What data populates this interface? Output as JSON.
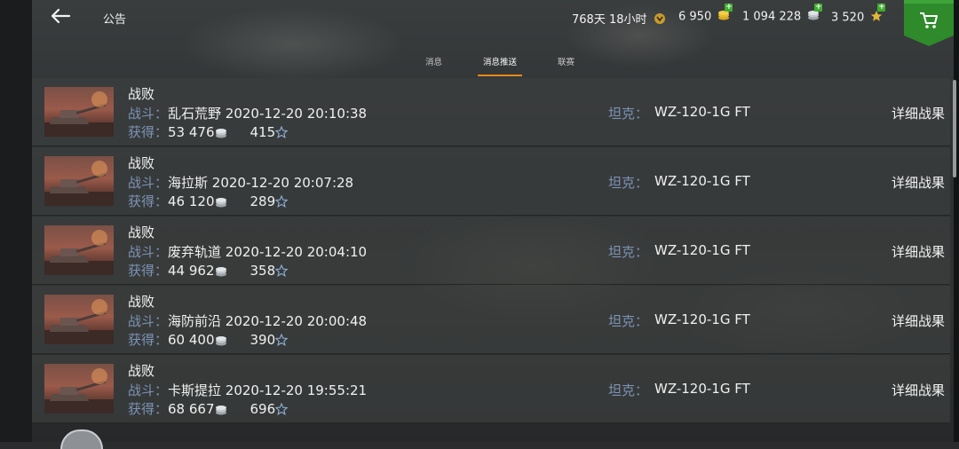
{
  "header": {
    "title": "公告",
    "premium_time": "768天 18小时",
    "gold": "6 950",
    "silver": "1 094 228",
    "free_xp": "3 520"
  },
  "tabs": [
    {
      "label": "消息",
      "active": false
    },
    {
      "label": "消息推送",
      "active": true
    },
    {
      "label": "联赛",
      "active": false
    }
  ],
  "colors": {
    "accent": "#e8881a",
    "label": "#7d93b6",
    "shop": "#2e8a2a"
  },
  "rows": [
    {
      "result": "战败",
      "battle_label": "战斗：",
      "map_time": "乱石荒野 2020-12-20 20:10:38",
      "earn_label": "获得：",
      "credits": "53 476",
      "xp": "415",
      "tank_label": "坦克：",
      "tank": "WZ-120-1G FT",
      "details": "详细战果"
    },
    {
      "result": "战败",
      "battle_label": "战斗：",
      "map_time": "海拉斯 2020-12-20 20:07:28",
      "earn_label": "获得：",
      "credits": "46 120",
      "xp": "289",
      "tank_label": "坦克：",
      "tank": "WZ-120-1G FT",
      "details": "详细战果"
    },
    {
      "result": "战败",
      "battle_label": "战斗：",
      "map_time": "废弃轨道 2020-12-20 20:04:10",
      "earn_label": "获得：",
      "credits": "44 962",
      "xp": "358",
      "tank_label": "坦克：",
      "tank": "WZ-120-1G FT",
      "details": "详细战果"
    },
    {
      "result": "战败",
      "battle_label": "战斗：",
      "map_time": "海防前沿 2020-12-20 20:00:48",
      "earn_label": "获得：",
      "credits": "60 400",
      "xp": "390",
      "tank_label": "坦克：",
      "tank": "WZ-120-1G FT",
      "details": "详细战果"
    },
    {
      "result": "战败",
      "battle_label": "战斗：",
      "map_time": "卡斯提拉 2020-12-20 19:55:21",
      "earn_label": "获得：",
      "credits": "68 667",
      "xp": "696",
      "tank_label": "坦克：",
      "tank": "WZ-120-1G FT",
      "details": "详细战果"
    }
  ]
}
